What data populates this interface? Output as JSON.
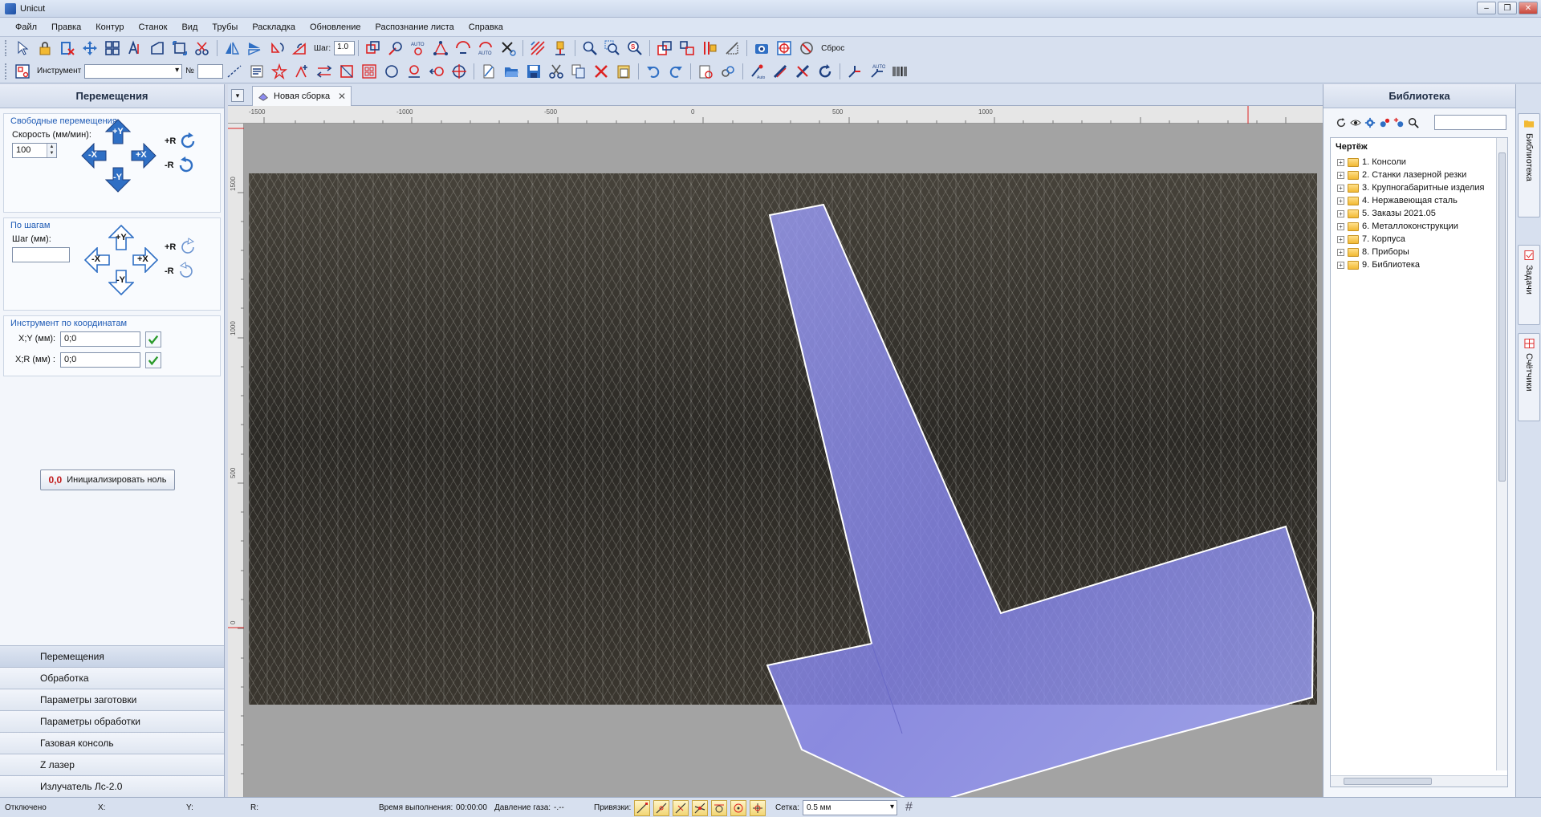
{
  "window": {
    "title": "Unicut"
  },
  "menu": [
    "Файл",
    "Правка",
    "Контур",
    "Станок",
    "Вид",
    "Трубы",
    "Раскладка",
    "Обновление",
    "Распознание листа",
    "Справка"
  ],
  "toolbar": {
    "step_label": "Шаг:",
    "step_value": "1.0",
    "reset_label": "Сброс",
    "tool_label": "Инструмент",
    "tool_value": "",
    "number_label": "№",
    "number_value": "",
    "auto_badge": "AUTO"
  },
  "left_panel": {
    "title": "Перемещения",
    "free_moves": {
      "title": "Свободные перемещения",
      "speed_label": "Скорость (мм/мин):",
      "speed_value": "100",
      "plus_y": "+Y",
      "minus_y": "-Y",
      "plus_x": "+X",
      "minus_x": "-X",
      "plus_r": "+R",
      "minus_r": "-R"
    },
    "step_moves": {
      "title": "По шагам",
      "step_label": "Шаг (мм):",
      "step_value": "",
      "plus_y": "+Y",
      "minus_y": "-Y",
      "plus_x": "+X",
      "minus_x": "-X",
      "plus_r": "+R",
      "minus_r": "-R"
    },
    "coords": {
      "title": "Инструмент по координатам",
      "xy_label": "X;Y (мм):",
      "xy_value": "0;0",
      "xr_label": "X;R (мм) :",
      "xr_value": "0;0"
    },
    "init_zero": {
      "badge": "0,0",
      "label": "Инициализировать ноль"
    },
    "accordion": [
      "Перемещения",
      "Обработка",
      "Параметры заготовки",
      "Параметры обработки",
      "Газовая консоль",
      "Z лазер",
      "Излучатель Лс-2.0"
    ],
    "accordion_active": 0
  },
  "document": {
    "tab_title": "Новая сборка",
    "ruler_x": [
      "-1500",
      "-1000",
      "-500",
      "0",
      "500",
      "1000"
    ],
    "ruler_y": [
      "1500",
      "1000",
      "500",
      "0"
    ]
  },
  "library": {
    "title": "Библиотека",
    "root": "Чертёж",
    "items": [
      "1. Консоли",
      "2. Станки лазерной резки",
      "3. Крупногабаритные изделия",
      "4. Нержавеющая сталь",
      "5. Заказы 2021.05",
      "6. Металлоконструкции",
      "7. Корпуса",
      "8. Приборы",
      "9. Библиотека"
    ]
  },
  "side_tabs": [
    "Библиотека",
    "Задачи",
    "Счётчики"
  ],
  "status": {
    "state": "Отключено",
    "x_label": "X:",
    "y_label": "Y:",
    "r_label": "R:",
    "exec_time_label": "Время выполнения:",
    "exec_time_value": "00:00:00",
    "gas_label": "Давление газа:",
    "gas_value": "-.--",
    "snaps_label": "Привязки:",
    "grid_label": "Сетка:",
    "grid_value": "0.5 мм"
  },
  "colors": {
    "accent": "#1f5bb5",
    "part_fill": "#8c8cf0",
    "arrow_blue": "#2f6fc4",
    "snap_yellow": "#f2d574"
  }
}
